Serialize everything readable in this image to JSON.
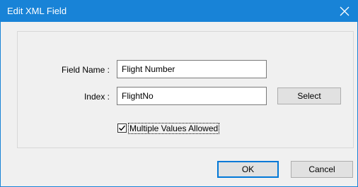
{
  "dialog": {
    "title": "Edit XML Field",
    "close_icon": "close-icon"
  },
  "form": {
    "field_name_label": "Field Name :",
    "field_name_value": "Flight Number",
    "index_label": "Index :",
    "index_value": "FlightNo",
    "select_label": "Select",
    "multiple_values_label": "Multiple Values Allowed",
    "multiple_values_checked": true
  },
  "footer": {
    "ok_label": "OK",
    "cancel_label": "Cancel"
  },
  "colors": {
    "titlebar": "#1883d7",
    "default_button_border": "#0078d7"
  }
}
